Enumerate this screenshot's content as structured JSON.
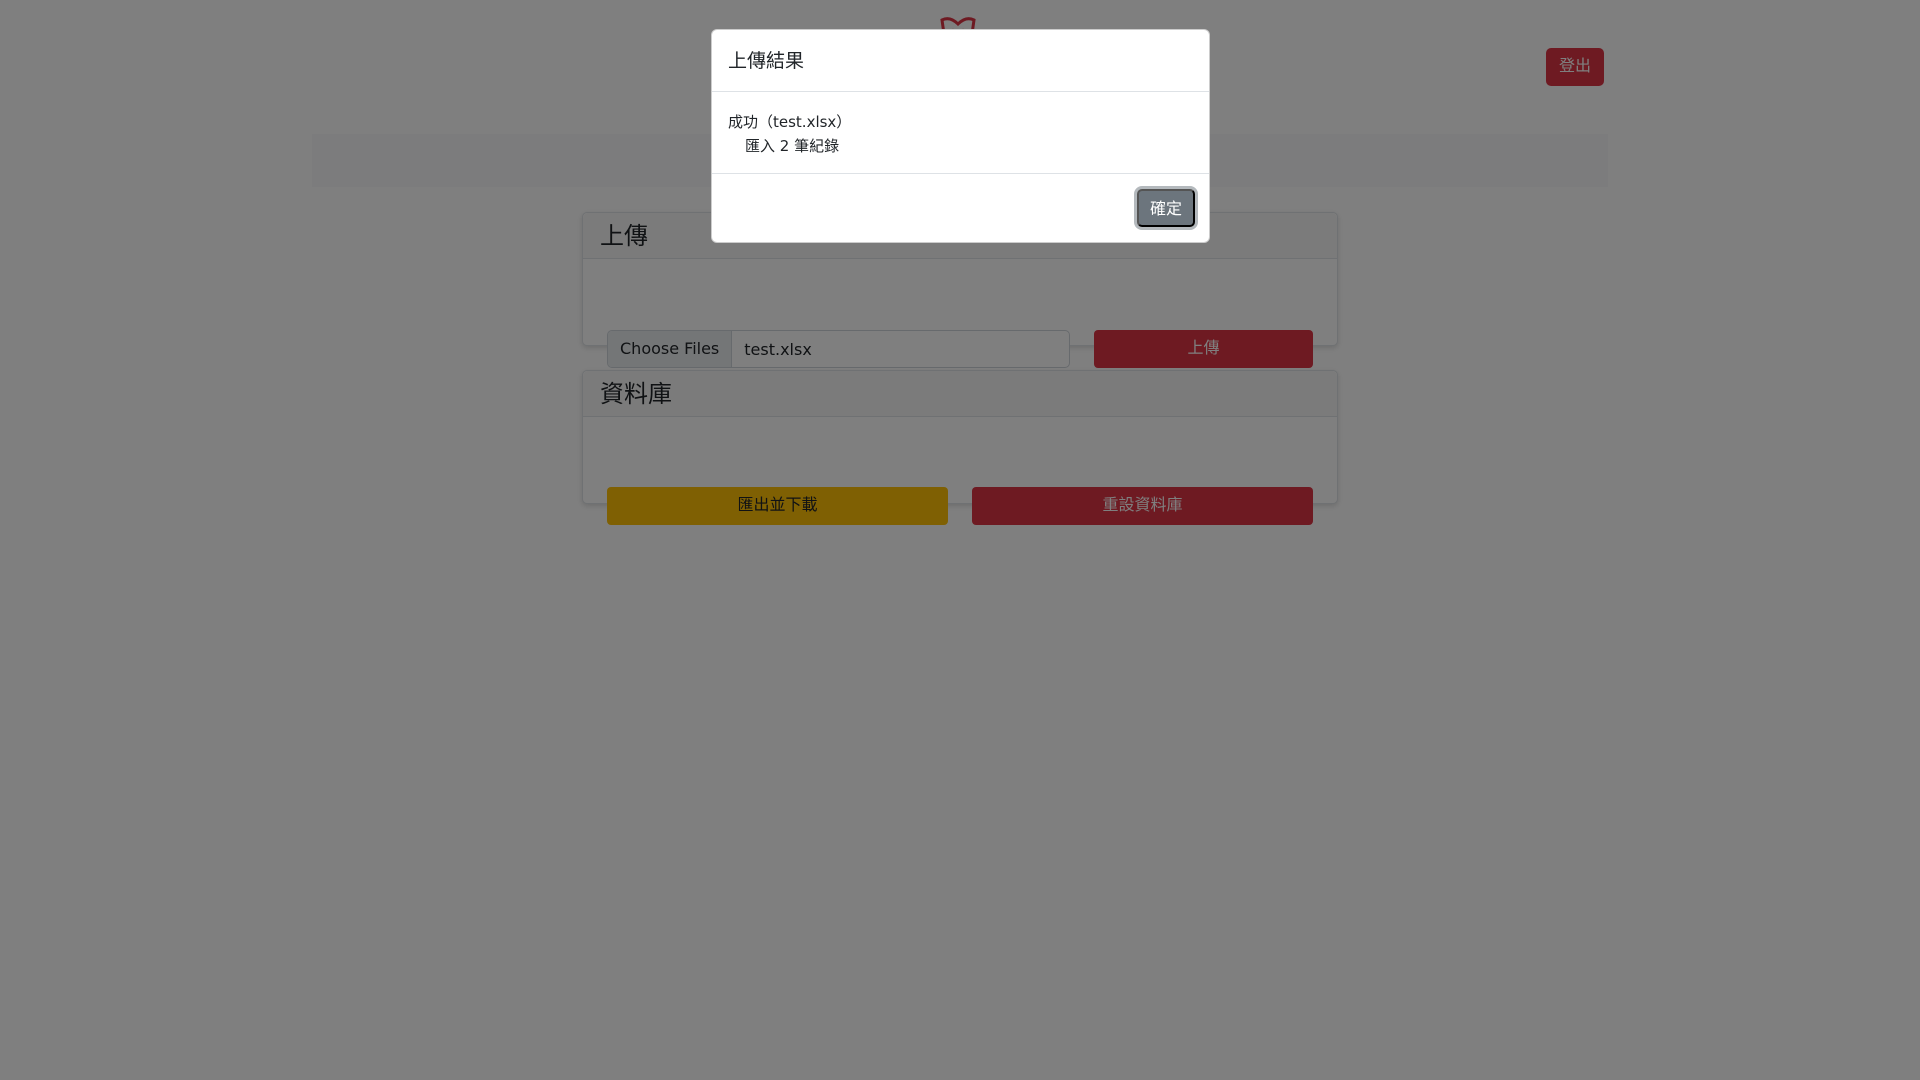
{
  "header": {
    "logo_icon": "ribbon-logo-icon",
    "logout_label": "登出"
  },
  "upload_card": {
    "title": "上傳",
    "choose_files_label": "Choose Files",
    "file_name": "test.xlsx",
    "upload_button": "上傳"
  },
  "db_card": {
    "title": "資料庫",
    "export_button": "匯出並下載",
    "reset_button": "重設資料庫"
  },
  "modal": {
    "title": "上傳結果",
    "line1": "成功（test.xlsx）",
    "line2": "匯入 2 筆紀錄",
    "confirm_button": "確定"
  },
  "colors": {
    "danger": "#dc3545",
    "warning": "#ffc107",
    "secondary": "#6c757d",
    "backdrop": "rgba(0,0,0,0.5)"
  }
}
